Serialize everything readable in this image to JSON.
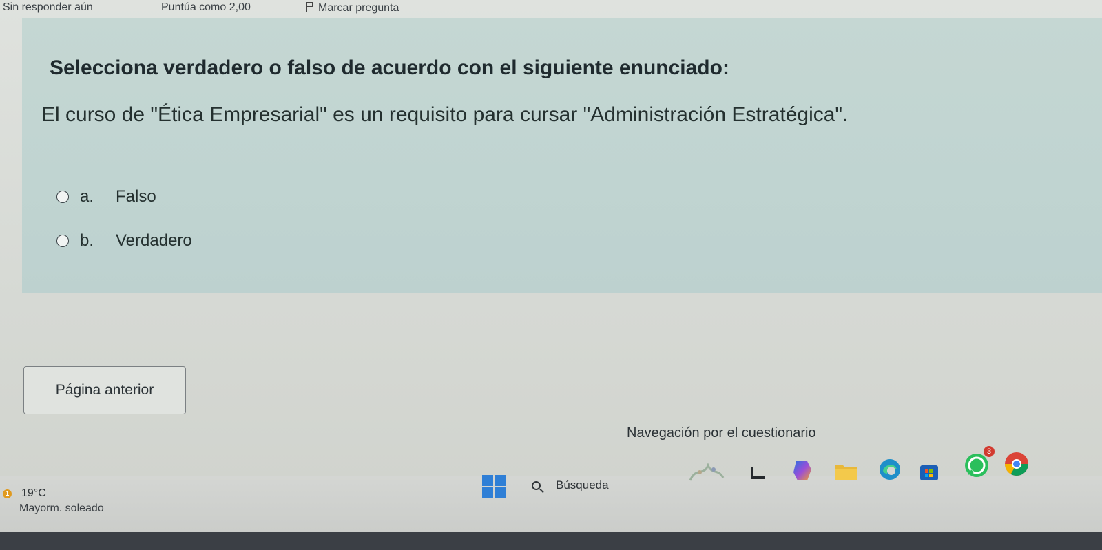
{
  "info_bar": {
    "status": "Sin responder aún",
    "score": "Puntúa como 2,00",
    "flag_label": "Marcar pregunta"
  },
  "question": {
    "prompt": "Selecciona verdadero o falso de acuerdo con el siguiente enunciado:",
    "statement": "El curso de \"Ética Empresarial\" es un requisito para cursar \"Administración Estratégica\".",
    "options": [
      {
        "letter": "a.",
        "label": "Falso",
        "selected": false
      },
      {
        "letter": "b.",
        "label": "Verdadero",
        "selected": false
      }
    ]
  },
  "navigation": {
    "prev_label": "Página anterior",
    "quiz_nav_title": "Navegación por el cuestionario"
  },
  "taskbar": {
    "weather_temp": "19°C",
    "weather_desc": "Mayorm. soleado",
    "weather_badge": "1",
    "search_placeholder": "Búsqueda",
    "notification_count": "3",
    "apps": [
      "widgets-icon",
      "terminal-icon",
      "copilot-icon",
      "file-explorer-icon",
      "edge-icon",
      "store-icon",
      "whatsapp-icon",
      "chrome-icon"
    ]
  },
  "colors": {
    "panel": "#c2d6d3",
    "page": "#dcdfdb",
    "accent_windows": "#2f7fd6",
    "edge": "#1f8fc9",
    "whatsapp": "#2bbf5c"
  }
}
